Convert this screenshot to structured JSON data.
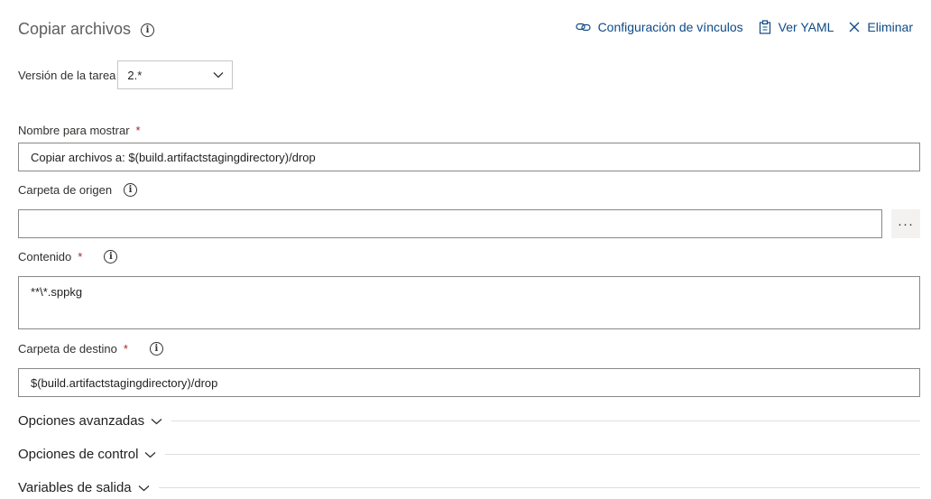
{
  "header": {
    "title": "Copiar archivos",
    "actions": {
      "link_settings": "Configuración de vínculos",
      "view_yaml": "Ver YAML",
      "remove": "Eliminar"
    }
  },
  "version": {
    "label": "Versión de la tarea",
    "value": "2.*"
  },
  "fields": {
    "display_name": {
      "label": "Nombre para mostrar",
      "required_mark": "*",
      "value": "Copiar archivos a: $(build.artifactstagingdirectory)/drop"
    },
    "source_folder": {
      "label": "Carpeta de origen",
      "value": "",
      "browse": "···"
    },
    "contents": {
      "label": "Contenido",
      "required_mark": "*",
      "value": "**\\*.sppkg"
    },
    "target_folder": {
      "label": "Carpeta de destino",
      "required_mark": "*",
      "value": "$(build.artifactstagingdirectory)/drop"
    }
  },
  "sections": {
    "advanced": "Opciones avanzadas",
    "control": "Opciones de control",
    "output": "Variables de salida"
  },
  "colors": {
    "link": "#0f4a85",
    "required": "#a4262c",
    "border": "#8a8886"
  }
}
